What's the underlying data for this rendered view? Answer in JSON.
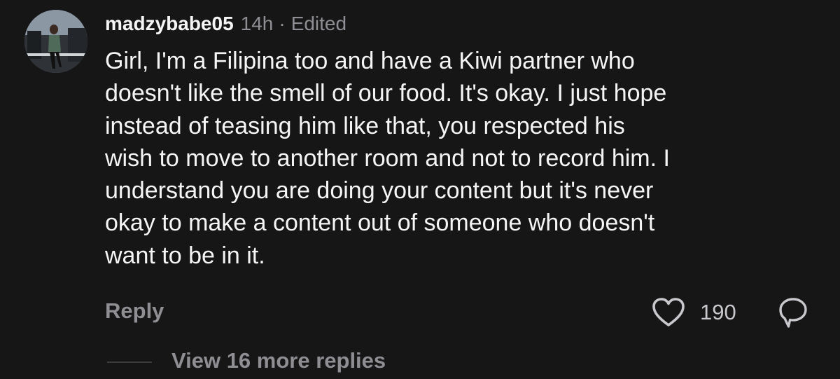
{
  "comment": {
    "username": "madzybabe05",
    "time": "14h",
    "separator": "·",
    "edited": "Edited",
    "lines": [
      "Girl, I'm a Filipina too and have a Kiwi partner who",
      "doesn't like the smell of our food. It's okay. I just hope",
      "instead of teasing him like that, you respected his",
      "wish to move to another room and not to record him. I",
      "understand you are doing your content but it's never",
      "okay to make a content out of someone who doesn't",
      "want to be in it."
    ],
    "reply_label": "Reply",
    "like_count": "190",
    "view_replies_label": "View 16 more replies"
  },
  "icons": {
    "like": "heart-icon",
    "share": "share-icon"
  },
  "colors": {
    "background": "#161617",
    "primary_text": "#f5f5f5",
    "secondary_text": "#8e8e93"
  }
}
